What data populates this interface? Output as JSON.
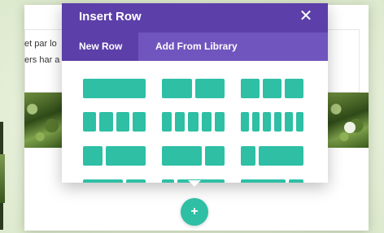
{
  "background_page": {
    "text_lines": [
      "et par lo",
      "ers har a"
    ]
  },
  "modal": {
    "title": "Insert Row",
    "close_icon": "close-icon",
    "tabs": [
      {
        "label": "New Row",
        "active": true
      },
      {
        "label": "Add From Library",
        "active": false
      }
    ],
    "column_color": "#2ebfa5",
    "header_color": "#5c3fa9",
    "tab_bar_color": "#7155be",
    "layouts": [
      {
        "name": "layout-1-col",
        "columns": [
          1
        ]
      },
      {
        "name": "layout-2-col",
        "columns": [
          1,
          1
        ]
      },
      {
        "name": "layout-3-col",
        "columns": [
          1,
          1,
          1
        ]
      },
      {
        "name": "layout-4-col",
        "columns": [
          1,
          1,
          1,
          1
        ]
      },
      {
        "name": "layout-5-col",
        "columns": [
          1,
          1,
          1,
          1,
          1
        ]
      },
      {
        "name": "layout-6-col",
        "columns": [
          1,
          1,
          1,
          1,
          1,
          1
        ]
      },
      {
        "name": "layout-1-3-2-3",
        "columns": [
          1,
          2
        ]
      },
      {
        "name": "layout-2-3-1-3",
        "columns": [
          2,
          1
        ]
      },
      {
        "name": "layout-1-4-3-4",
        "columns": [
          1,
          3
        ]
      },
      {
        "name": "layout-partial-a",
        "columns": [
          2,
          1
        ],
        "partial": true
      },
      {
        "name": "layout-partial-b",
        "columns": [
          1,
          4
        ],
        "partial": true
      },
      {
        "name": "layout-partial-c",
        "columns": [
          3,
          1
        ],
        "partial": true
      }
    ]
  },
  "add_row_button": {
    "label": "+",
    "icon": "plus-icon"
  }
}
